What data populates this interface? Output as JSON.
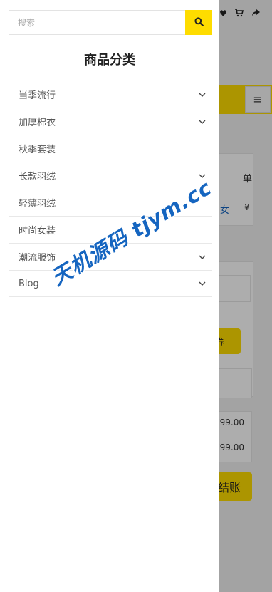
{
  "search": {
    "placeholder": "搜索",
    "value": ""
  },
  "drawer": {
    "title": "商品分类",
    "categories": [
      {
        "label": "当季流行",
        "has_children": true
      },
      {
        "label": "加厚棉衣",
        "has_children": true
      },
      {
        "label": "秋季套装",
        "has_children": false
      },
      {
        "label": "长款羽绒",
        "has_children": true
      },
      {
        "label": "轻薄羽绒",
        "has_children": false
      },
      {
        "label": "时尚女装",
        "has_children": false
      },
      {
        "label": "潮流服饰",
        "has_children": true
      },
      {
        "label": "Blog",
        "has_children": true
      }
    ]
  },
  "background": {
    "header_icons": [
      "heart-icon",
      "cart-icon",
      "share-icon"
    ],
    "table_header_fragment": "单",
    "product_fragment": "女",
    "currency_fragment": "¥",
    "coupon_button_fragment": "券",
    "price_row_1": "99.00",
    "price_row_2": "99.00",
    "checkout_button_fragment": "结账"
  },
  "watermark": {
    "text": "天机源码 tjym.cc"
  },
  "colors": {
    "accent": "#fedc00",
    "watermark": "#1565c0"
  }
}
